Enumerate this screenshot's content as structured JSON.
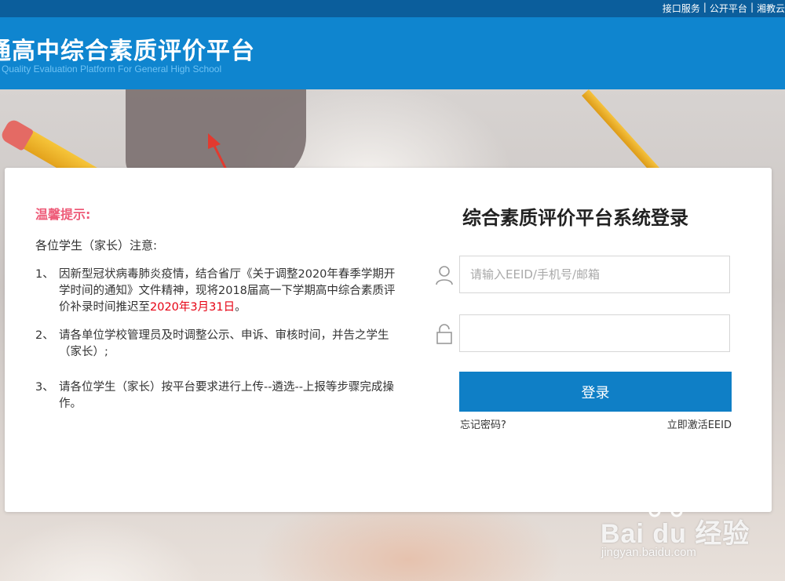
{
  "top_links": [
    "接口服务",
    "公开平台",
    "湘教云"
  ],
  "top_separator": "|",
  "header": {
    "title": "通高中综合素质评价平台",
    "subtitle": "Quality Evaluation Platform For General High School"
  },
  "notice": {
    "title": "温馨提示:",
    "intro": "各位学生（家长）注意:",
    "items": [
      {
        "num": "1、",
        "text": "因新型冠状病毒肺炎疫情，结合省厅《关于调整2020年春季学期开学时间的通知》文件精神，现将2018届高一下学期高中综合素质评价补录时间推迟至",
        "highlight": "2020年3月31日",
        "tail": "。"
      },
      {
        "num": "2、",
        "text": "请各单位学校管理员及时调整公示、申诉、审核时间，并告之学生（家长）;"
      },
      {
        "num": "3、",
        "text": "请各位学生（家长）按平台要求进行上传--遴选--上报等步骤完成操作。"
      }
    ]
  },
  "login": {
    "title": "综合素质评价平台系统登录",
    "username_placeholder": "请输入EEID/手机号/邮箱",
    "username_value": "",
    "password_value": "",
    "submit_label": "登录",
    "forgot_label": "忘记密码?",
    "activate_label": "立即激活EEID"
  },
  "watermark": {
    "brand": "Bai du 经验",
    "url": "jingyan.baidu.com"
  },
  "icons": {
    "user": "user-icon",
    "lock": "lock-icon",
    "arrow": "red-arrow-annotation"
  },
  "colors": {
    "header_blue": "#0f85cf",
    "button_blue": "#0f7fc6",
    "notice_pink": "#ee5b78",
    "highlight_red": "#e60012"
  }
}
